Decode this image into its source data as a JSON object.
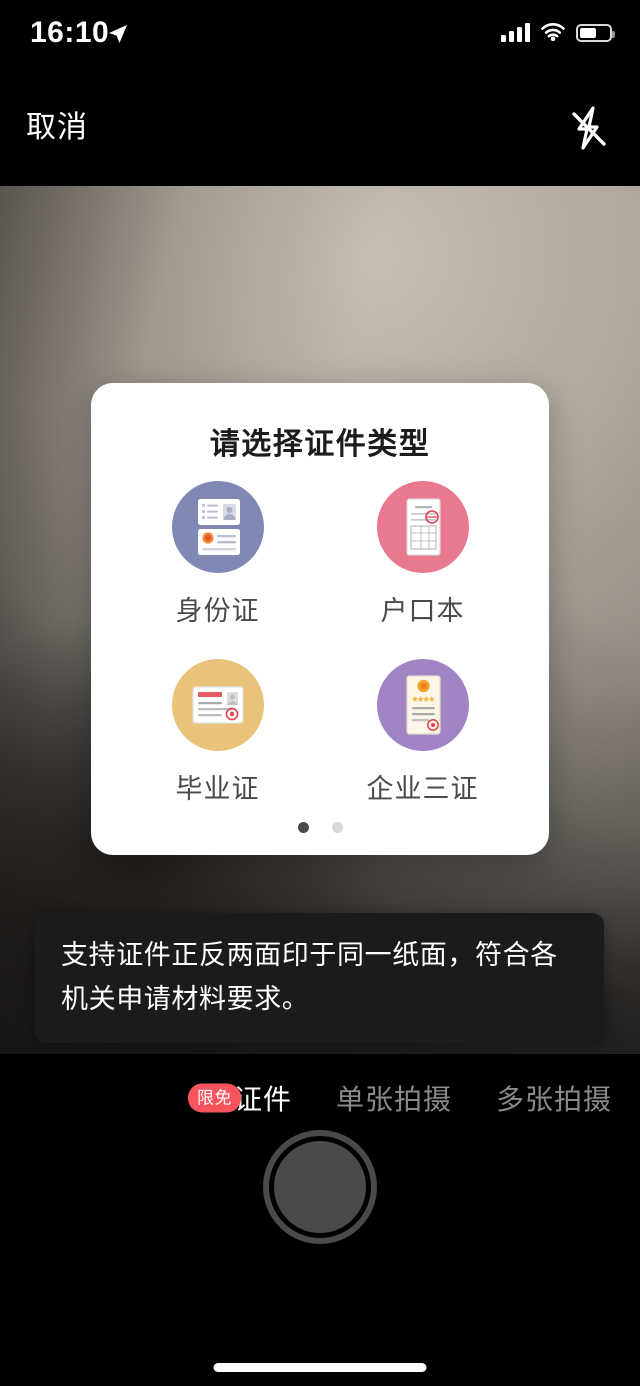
{
  "status_bar": {
    "time": "16:10",
    "location_icon": "location-arrow-icon",
    "signal_icon": "cellular-signal-icon",
    "wifi_icon": "wifi-icon",
    "battery_icon": "battery-icon",
    "battery_level_percent": 50
  },
  "nav_bar": {
    "cancel_label": "取消",
    "flash_icon": "flash-off-icon"
  },
  "dialog": {
    "title": "请选择证件类型",
    "items": [
      {
        "label": "身份证",
        "icon": "id-card-icon",
        "color": "#8089b6"
      },
      {
        "label": "户口本",
        "icon": "household-register-icon",
        "color": "#e8798e"
      },
      {
        "label": "毕业证",
        "icon": "graduation-certificate-icon",
        "color": "#e9c37a"
      },
      {
        "label": "企业三证",
        "icon": "enterprise-license-icon",
        "color": "#a184c4"
      }
    ],
    "pagination": {
      "total": 2,
      "active_index": 0
    }
  },
  "tooltip": {
    "text": "支持证件正反两面印于同一纸面，符合各机关申请材料要求。"
  },
  "bottom_bar": {
    "tabs": [
      {
        "label": "证件",
        "active": true,
        "badge": "限免"
      },
      {
        "label": "单张拍摄",
        "active": false,
        "badge": null
      },
      {
        "label": "多张拍摄",
        "active": false,
        "badge": null
      }
    ],
    "shutter_label": "shutter-button",
    "badge_color": "#f8545e"
  }
}
